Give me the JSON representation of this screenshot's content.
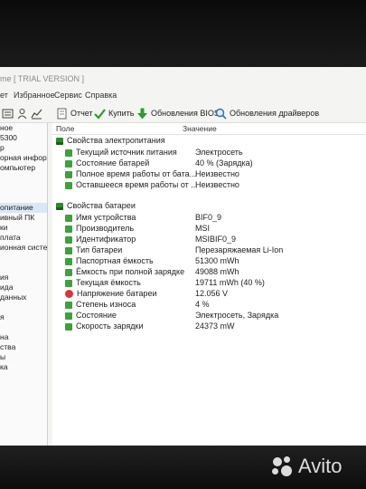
{
  "window": {
    "title": "me [ TRIAL VERSION ]"
  },
  "menu": [
    "ет",
    "Избранное",
    "Сервис",
    "Справка"
  ],
  "toolbar": {
    "report": "Отчет",
    "buy": "Купить",
    "bios_update": "Обновления BIOS",
    "driver_update": "Обновления драйверов"
  },
  "sidebar": {
    "items": [
      "ное",
      "5300",
      "р",
      "орная информа",
      "омпьютер",
      "",
      "",
      "",
      "опитание",
      "ивный ПК",
      "ки",
      "плата",
      "ионная система",
      "",
      "ия",
      "ида",
      "данных",
      "",
      "я",
      "",
      "на",
      "ства",
      "ы",
      "ка"
    ]
  },
  "columns": {
    "field": "Поле",
    "value": "Значение"
  },
  "sections": {
    "power": "Свойства электропитания",
    "battery": "Свойства батареи"
  },
  "power_rows": [
    {
      "label": "Текущий источник питания",
      "value": "Электросеть"
    },
    {
      "label": "Состояние батарей",
      "value": "40 % (Зарядка)"
    },
    {
      "label": "Полное время работы от бата...",
      "value": "Неизвестно"
    },
    {
      "label": "Оставшееся время работы от ...",
      "value": "Неизвестно"
    }
  ],
  "battery_rows": [
    {
      "label": "Имя устройства",
      "value": "BIF0_9"
    },
    {
      "label": "Производитель",
      "value": "MSI"
    },
    {
      "label": "Идентификатор",
      "value": "MSIBIF0_9"
    },
    {
      "label": "Тип батареи",
      "value": "Перезаряжаемая Li-Ion"
    },
    {
      "label": "Паспортная ёмкость",
      "value": "51300 mWh"
    },
    {
      "label": "Ёмкость при полной зарядке",
      "value": "49088 mWh"
    },
    {
      "label": "Текущая ёмкость",
      "value": "19711 mWh  (40 %)"
    },
    {
      "label": "Напряжение батареи",
      "value": "12.056 V"
    },
    {
      "label": "Степень износа",
      "value": "4 %"
    },
    {
      "label": "Состояние",
      "value": "Электросеть, Зарядка"
    },
    {
      "label": "Скорость зарядки",
      "value": "24373 mW"
    }
  ],
  "watermark": {
    "text": "Avito"
  }
}
